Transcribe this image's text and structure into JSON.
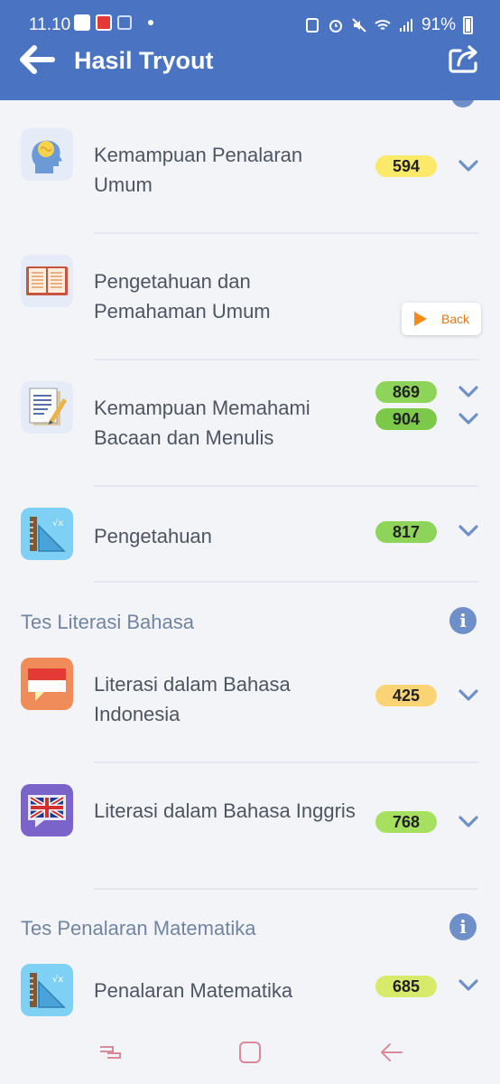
{
  "status_bar": {
    "time": "11.10",
    "battery": "91%"
  },
  "app_bar": {
    "title": "Hasil Tryout",
    "back_icon": "arrow-left-icon",
    "share_icon": "share-icon"
  },
  "back_popup": {
    "label": "Back"
  },
  "sections": [
    {
      "title": "Tes Literasi Bahasa"
    },
    {
      "title": "Tes Penalaran Matematika"
    }
  ],
  "items": [
    {
      "label": "Kemampuan Penalaran Umum",
      "score": "594",
      "score_color": "#fbe96a",
      "icon": "head-brain-icon"
    },
    {
      "label": "Pengetahuan dan Pemahaman Umum",
      "score": "869",
      "score_color": "#8fd45a",
      "icon": "open-book-icon"
    },
    {
      "label": "Kemampuan Memahami Bacaan dan Menulis",
      "score": "904",
      "score_color": "#7cc94a",
      "icon": "document-pen-icon"
    },
    {
      "label": "Pengetahuan",
      "score": "817",
      "score_color": "#8fd45a",
      "icon": "ruler-math-icon"
    },
    {
      "label": "Literasi dalam Bahasa Indonesia",
      "score": "425",
      "score_color": "#fad374",
      "icon": "indonesia-flag-chat-icon"
    },
    {
      "label": "Literasi dalam Bahasa Inggris",
      "score": "768",
      "score_color": "#a7e061",
      "icon": "uk-flag-chat-icon"
    },
    {
      "label": "Penalaran Matematika",
      "score": "685",
      "score_color": "#d7ea6a",
      "icon": "ruler-math-icon"
    }
  ],
  "nav": {
    "recent_icon": "recent-apps-icon",
    "home_icon": "home-icon",
    "back_icon": "nav-back-icon"
  }
}
